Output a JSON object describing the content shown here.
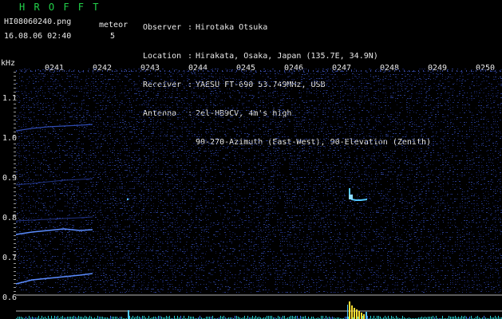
{
  "header": {
    "brand": "H R O F F T",
    "filename": "HI08060240.png",
    "timestamp": "16.08.06 02:40",
    "meteor_label": "meteor",
    "meteor_count": "5"
  },
  "station": {
    "observer_label": "Observer",
    "observer": "Hirotaka Otsuka",
    "location_label": "Location",
    "location": "Hirakata, Osaka, Japan (135.7E, 34.9N)",
    "receiver_label": "Receiver",
    "receiver": "YAESU FT-690 53.749MHz, USB",
    "antenna_label": "Antenna",
    "antenna_line1": "2el-HB9CV, 4m's high",
    "antenna_line2": "90-270-Azimuth (East-West), 90-Elevation (Zenith)",
    "separator": ":"
  },
  "axes": {
    "y_unit": "kHz",
    "y_ticks": [
      "1.1",
      "1.0",
      "0.9",
      "0.8",
      "0.7",
      "0.6"
    ],
    "x_ticks": [
      "0241",
      "0242",
      "0243",
      "0244",
      "0245",
      "0246",
      "0247",
      "0248",
      "0249",
      "0250"
    ]
  },
  "colors": {
    "background": "#000000",
    "noise": "#1c2a6e",
    "trace": "#4f7dff",
    "echo": "#53c6ff",
    "baseline": "#25d4d4",
    "burst": "#ffe033",
    "gridline": "#b8b8b8",
    "brand": "#22d24a"
  }
}
